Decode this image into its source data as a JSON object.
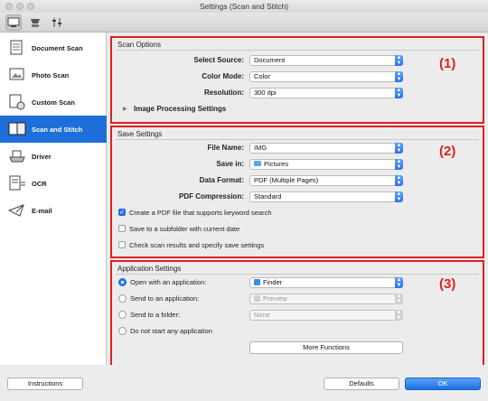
{
  "window": {
    "title": "Settings (Scan and Stitch)"
  },
  "sidebar": {
    "items": [
      {
        "label": "Document Scan",
        "icon": "document-scan-icon"
      },
      {
        "label": "Photo Scan",
        "icon": "photo-scan-icon"
      },
      {
        "label": "Custom Scan",
        "icon": "custom-scan-icon"
      },
      {
        "label": "Scan and Stitch",
        "icon": "scan-stitch-icon",
        "selected": true
      },
      {
        "label": "Driver",
        "icon": "driver-icon"
      },
      {
        "label": "OCR",
        "icon": "ocr-icon"
      },
      {
        "label": "E-mail",
        "icon": "email-icon"
      }
    ]
  },
  "scan_options": {
    "title": "Scan Options",
    "marker": "(1)",
    "select_source_label": "Select Source:",
    "select_source_value": "Document",
    "color_mode_label": "Color Mode:",
    "color_mode_value": "Color",
    "resolution_label": "Resolution:",
    "resolution_value": "300 dpi",
    "image_processing_label": "Image Processing Settings"
  },
  "save_settings": {
    "title": "Save Settings",
    "marker": "(2)",
    "file_name_label": "File Name:",
    "file_name_value": "IMG",
    "save_in_label": "Save in:",
    "save_in_value": "Pictures",
    "data_format_label": "Data Format:",
    "data_format_value": "PDF (Multiple Pages)",
    "pdf_compression_label": "PDF Compression:",
    "pdf_compression_value": "Standard",
    "keyword_search_label": "Create a PDF file that supports keyword search",
    "subfolder_label": "Save to a subfolder with current date",
    "check_results_label": "Check scan results and specify save settings"
  },
  "application_settings": {
    "title": "Application Settings",
    "marker": "(3)",
    "open_with_label": "Open with an application:",
    "open_with_value": "Finder",
    "send_app_label": "Send to an application:",
    "send_app_value": "Preview",
    "send_folder_label": "Send to a folder:",
    "send_folder_value": "None",
    "no_app_label": "Do not start any application",
    "more_functions_label": "More Functions"
  },
  "footer": {
    "instructions_label": "Instructions",
    "defaults_label": "Defaults",
    "ok_label": "OK"
  }
}
